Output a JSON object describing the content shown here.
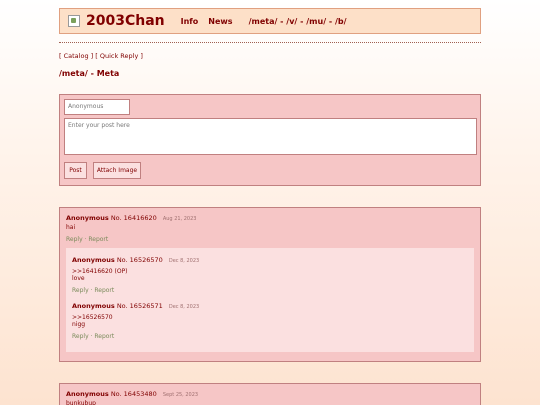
{
  "header": {
    "title": "2003Chan",
    "nav": [
      "Info",
      "News"
    ],
    "boards": [
      "/meta/",
      "/v/",
      "/mu/",
      "/b/"
    ]
  },
  "subnav": {
    "catalog": "[ Catalog ]",
    "quick_reply": "[ Quick Reply ]"
  },
  "board_title": "/meta/ - Meta",
  "form": {
    "name_placeholder": "Anonymous",
    "post_placeholder": "Enter your post here",
    "post_button": "Post",
    "attach_button": "Attach Image"
  },
  "threads": [
    {
      "op": {
        "name": "Anonymous",
        "number": "No. 16416620",
        "date": "Aug 21, 2023",
        "lines": [
          "hai"
        ],
        "reply_label": "Reply",
        "report_label": "Report"
      },
      "replies": [
        {
          "name": "Anonymous",
          "number": "No. 16526570",
          "date": "Dec 8, 2023",
          "lines": [
            ">>16416620 (OP)",
            "love"
          ],
          "reply_label": "Reply",
          "report_label": "Report"
        },
        {
          "name": "Anonymous",
          "number": "No. 16526571",
          "date": "Dec 8, 2023",
          "lines": [
            ">>16526570",
            "nigg"
          ],
          "reply_label": "Reply",
          "report_label": "Report"
        }
      ]
    },
    {
      "op": {
        "name": "Anonymous",
        "number": "No. 16453480",
        "date": "Sept 25, 2023",
        "lines": [
          "bunkubup"
        ]
      }
    }
  ],
  "colors": {
    "accent": "#800000",
    "panel": "#f6c6c6",
    "reply_panel": "#fbe0e0",
    "header_bg": "#fde0c8",
    "action_link": "#7a8a5a"
  }
}
